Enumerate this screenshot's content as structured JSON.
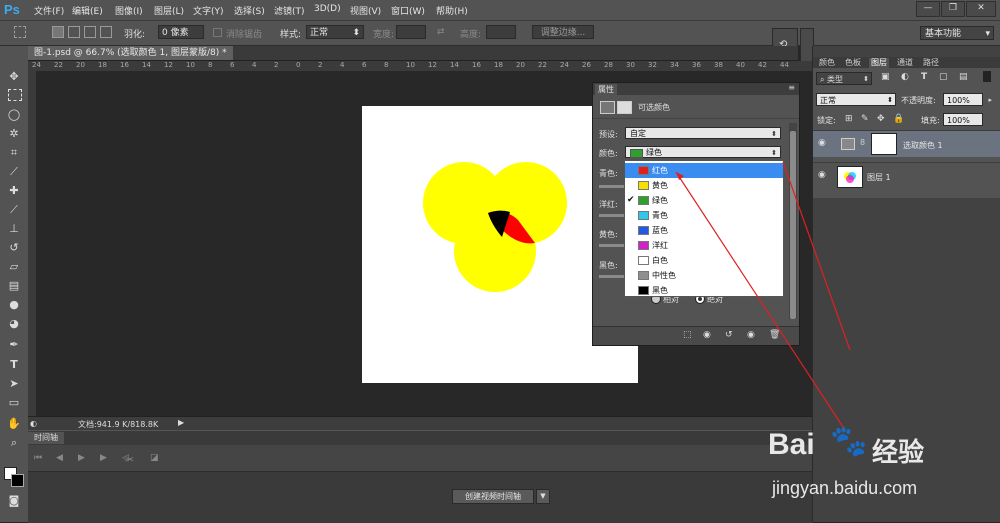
{
  "app": {
    "logo": "Ps",
    "menu": [
      "文件(F)",
      "编辑(E)",
      "图像(I)",
      "图层(L)",
      "文字(Y)",
      "选择(S)",
      "滤镜(T)",
      "3D(D)",
      "视图(V)",
      "窗口(W)",
      "帮助(H)"
    ]
  },
  "options": {
    "feather_label": "羽化:",
    "feather_value": "0 像素",
    "antialias": "消除锯齿",
    "style_label": "样式:",
    "style_value": "正常",
    "width_label": "宽度:",
    "height_label": "高度:",
    "refine_edge": "调整边缘...",
    "workspace": "基本功能"
  },
  "document": {
    "tab_title": "图-1.psd @ 66.7% (选取颜色 1, 图层蒙版/8) *",
    "ruler": [
      "24",
      "22",
      "20",
      "18",
      "16",
      "14",
      "12",
      "10",
      "8",
      "6",
      "4",
      "2",
      "0",
      "2",
      "4",
      "6",
      "8",
      "10",
      "12",
      "14",
      "16",
      "18",
      "20",
      "22",
      "24",
      "26",
      "28",
      "30",
      "32",
      "34",
      "36",
      "38",
      "40",
      "42",
      "44"
    ],
    "status": "文档:941.9 K/818.8K"
  },
  "timeline": {
    "title": "时间轴",
    "create_button": "创建视频时间轴"
  },
  "properties": {
    "tab": "属性",
    "title": "可选颜色",
    "preset_label": "预设:",
    "preset_value": "自定",
    "colors_label": "颜色:",
    "colors_value": "绿色",
    "cyan_label": "青色:",
    "magenta_label": "洋红:",
    "yellow_label": "黄色:",
    "black_label": "黑色:",
    "relative": "相对",
    "absolute": "绝对",
    "options": [
      {
        "label": "红色",
        "color": "#e02020",
        "selected": true,
        "checked": false
      },
      {
        "label": "黄色",
        "color": "#f5e000",
        "selected": false,
        "checked": false
      },
      {
        "label": "绿色",
        "color": "#2ea02e",
        "selected": false,
        "checked": true
      },
      {
        "label": "青色",
        "color": "#30c8e8",
        "selected": false,
        "checked": false
      },
      {
        "label": "蓝色",
        "color": "#1e5ae6",
        "selected": false,
        "checked": false
      },
      {
        "label": "洋红",
        "color": "#d020c8",
        "selected": false,
        "checked": false
      },
      {
        "label": "白色",
        "color": "#ffffff",
        "selected": false,
        "checked": false
      },
      {
        "label": "中性色",
        "color": "#909090",
        "selected": false,
        "checked": false
      },
      {
        "label": "黑色",
        "color": "#000000",
        "selected": false,
        "checked": false
      }
    ]
  },
  "layers": {
    "tabs": [
      "颜色",
      "色板",
      "图层",
      "通道",
      "路径"
    ],
    "kind_label": "类型",
    "blend_mode": "正常",
    "opacity_label": "不透明度:",
    "opacity_value": "100%",
    "lock_label": "锁定:",
    "fill_label": "填充:",
    "fill_value": "100%",
    "items": [
      {
        "name": "选取颜色 1"
      },
      {
        "name": "图层 1"
      }
    ]
  },
  "watermark": {
    "brand": "Bai",
    "brand_cn": "经验",
    "url": "jingyan.baidu.com"
  },
  "colors": {
    "circle": "#ffff00",
    "overlap_red": "#ff0000",
    "arrow": "#e02020"
  }
}
